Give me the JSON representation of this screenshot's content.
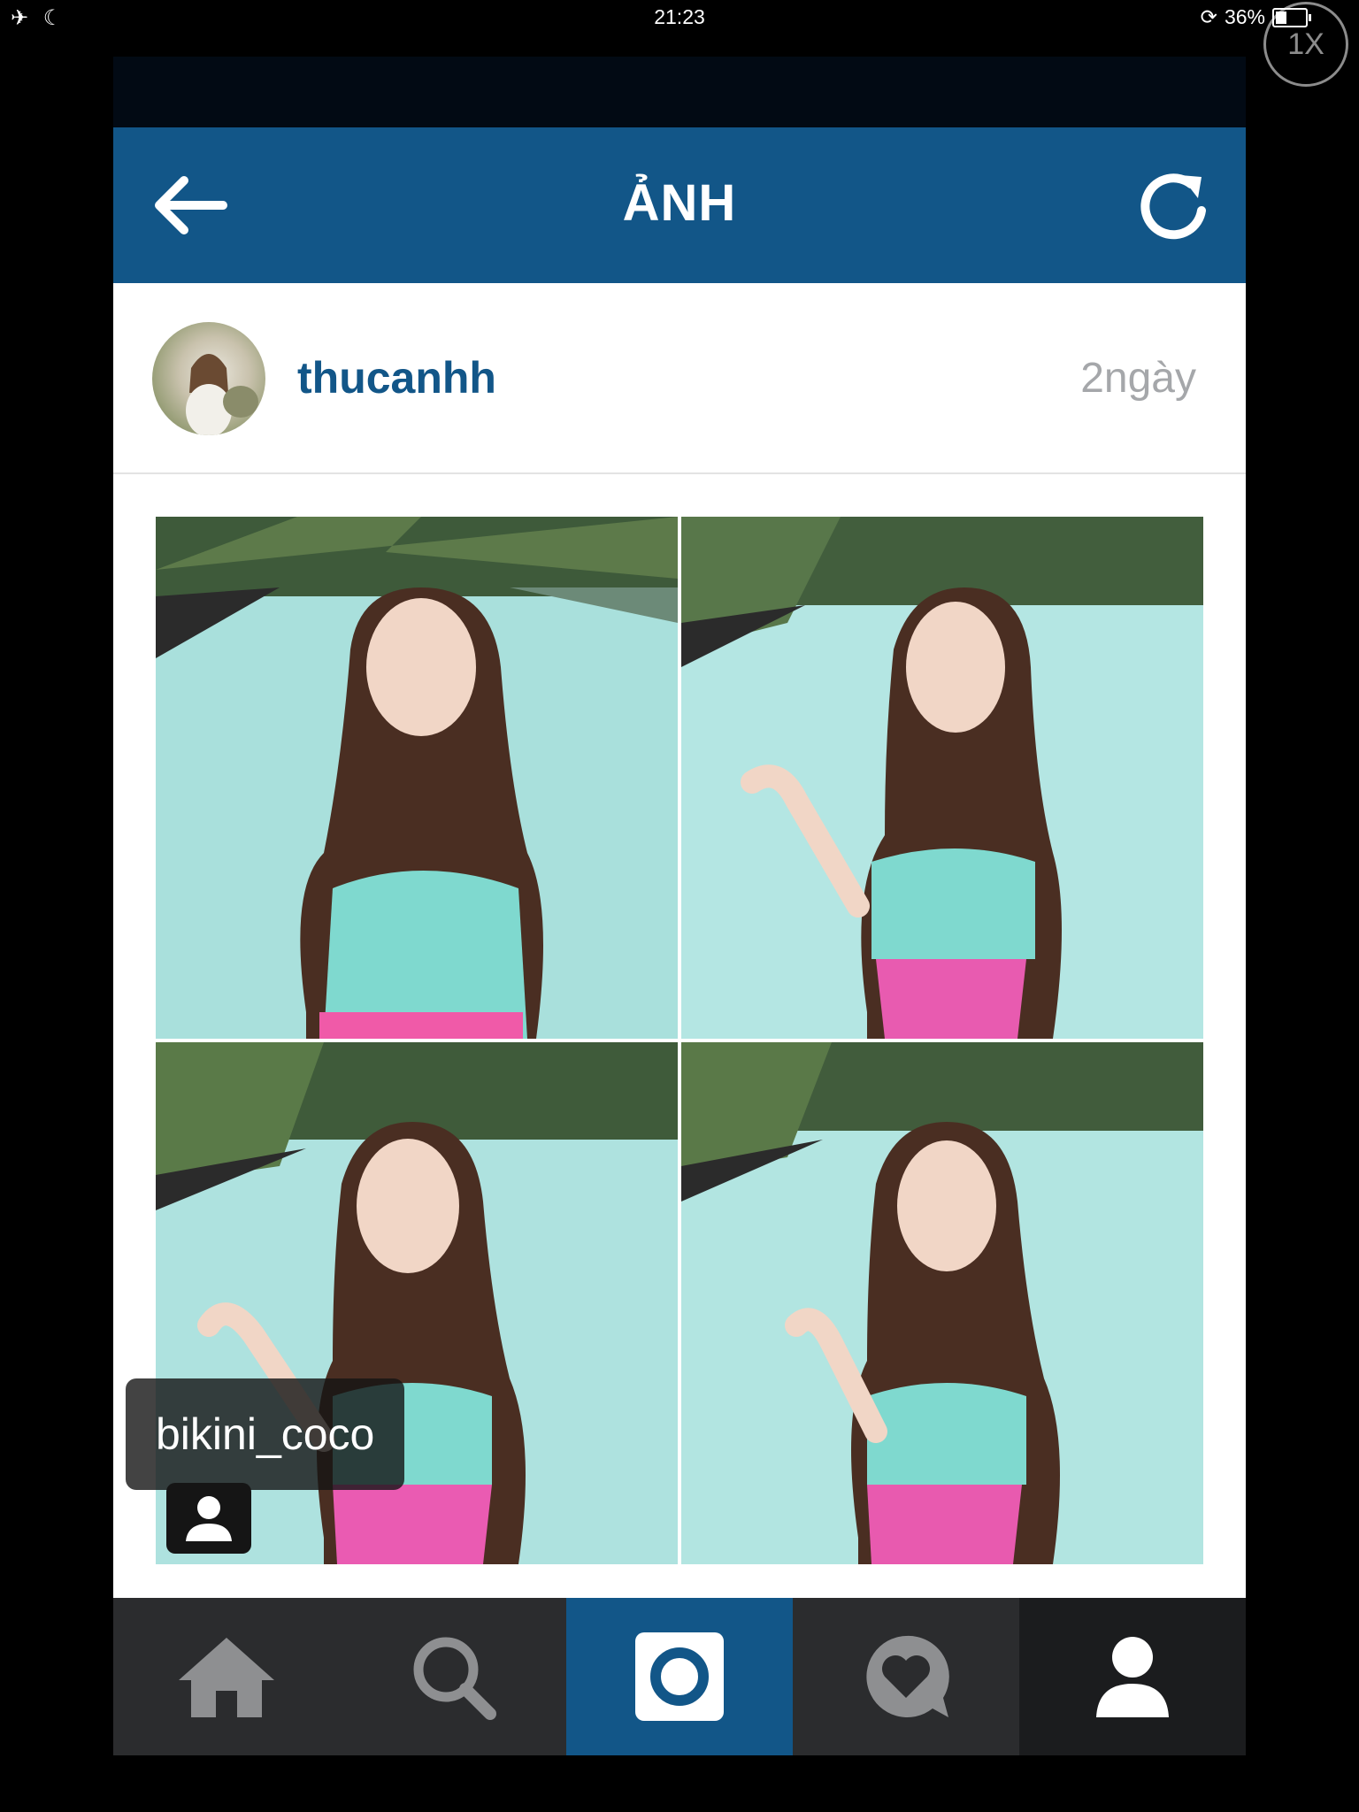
{
  "status_bar": {
    "time": "21:23",
    "battery": "36%",
    "battery_level": 0.36,
    "left_icons": [
      "airplane-mode-icon",
      "do-not-disturb-icon"
    ],
    "orientation_lock_icon": "orientation-lock-icon"
  },
  "zoom_badge": "1X",
  "navbar": {
    "title": "ẢNH",
    "back_icon": "back-arrow-icon",
    "refresh_icon": "refresh-icon"
  },
  "post": {
    "username": "thucanhh",
    "time": "2ngày",
    "tag": "bikini_coco"
  },
  "tabbar": {
    "tabs": [
      {
        "name": "home",
        "icon": "home-icon",
        "active": false
      },
      {
        "name": "explore",
        "icon": "search-icon",
        "active": false
      },
      {
        "name": "camera",
        "icon": "camera-icon",
        "active": true
      },
      {
        "name": "activity",
        "icon": "heart-bubble-icon",
        "active": false
      },
      {
        "name": "profile",
        "icon": "profile-icon",
        "active": false
      }
    ]
  },
  "colors": {
    "brand_blue": "#125688",
    "timestamp_gray": "#a5a7aa",
    "tabbar": "#2b2c2e"
  }
}
